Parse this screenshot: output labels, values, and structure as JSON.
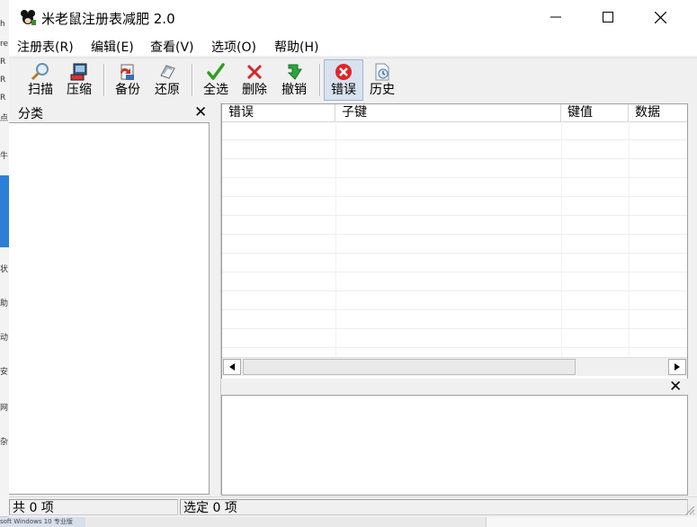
{
  "window": {
    "title": "米老鼠注册表减肥 2.0"
  },
  "menu": [
    "注册表(R)",
    "编辑(E)",
    "查看(V)",
    "选项(O)",
    "帮助(H)"
  ],
  "toolbar": {
    "scan": "扫描",
    "compress": "压缩",
    "backup": "备份",
    "restore": "还原",
    "select_all": "全选",
    "delete": "删除",
    "undo": "撤销",
    "errors": "错误",
    "history": "历史"
  },
  "left_pane": {
    "title": "分类"
  },
  "grid": {
    "columns": [
      "错误",
      "子键",
      "键值",
      "数据"
    ],
    "rows": []
  },
  "status": {
    "total": "共 0 项",
    "selected": "选定 0 项"
  },
  "background_desktop": {
    "taskbar_text": "soft Windows 10 专业版"
  },
  "colors": {
    "window_bg": "#f0f0f0",
    "titlebar_bg": "#ffffff",
    "accent_blue": "#2b7fd6",
    "check_green": "#2e9e1f",
    "error_red": "#e0242a"
  }
}
